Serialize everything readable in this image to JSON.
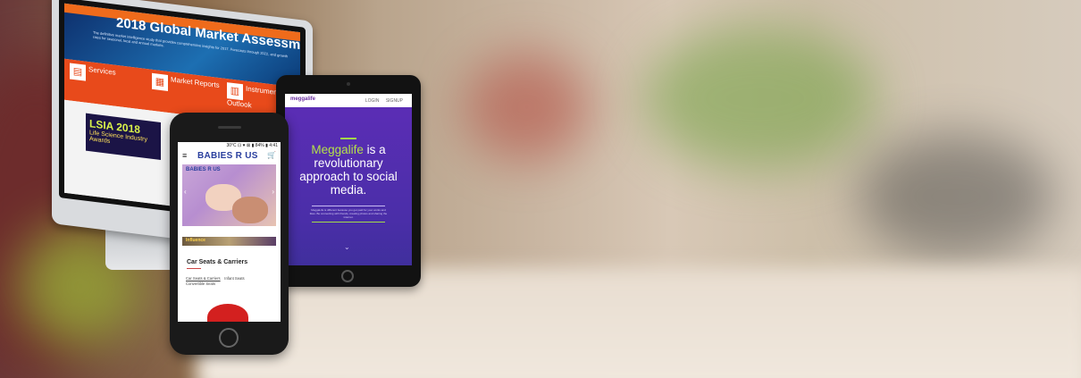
{
  "desktop": {
    "title": "2018 Global Market Assessment",
    "intro": "The definitive market intelligence study that provides comprehensive insights for 2017. Forecasts through 2022, and growth rates for seasonal, local and annual markets.",
    "cards": [
      {
        "label": "Services",
        "icon": "services-icon",
        "glyph": "▤"
      },
      {
        "label": "Market Reports",
        "icon": "report-icon",
        "glyph": "▦"
      },
      {
        "label": "Instrument Outlook",
        "icon": "chart-icon",
        "glyph": "▥"
      }
    ],
    "award": {
      "logo": "LSIA 2018",
      "text": "Life Science Industry Awards"
    }
  },
  "tablet": {
    "logo": "meggalife",
    "nav": [
      "LOGIN",
      "SIGNUP"
    ],
    "headline_highlight": "Meggalife",
    "headline_rest": " is a revolutionary approach to social media.",
    "body": "MeggaLife is different because you get paid for your works and likes. Be connecting with friends, creating photos and sharing the internet.",
    "scroll_icon": "chevron-down-icon"
  },
  "phone": {
    "status": "30°C ⊡ ♥ ⊠ ▮ 84% ▮ 4:41",
    "brand": "BABIES R US",
    "banner_logo": "BABIES R US",
    "strip_label": "Influence",
    "section_title": "Car Seats & Carriers",
    "links": [
      "Car Seats & Carriers",
      "Infant Seats",
      "Convertible Seats"
    ]
  },
  "colors": {
    "desktop_accent": "#e84a1b",
    "tablet_purple": "#5b2db5",
    "tablet_highlight": "#b4e04a",
    "brand_blue": "#2a3f9e"
  }
}
